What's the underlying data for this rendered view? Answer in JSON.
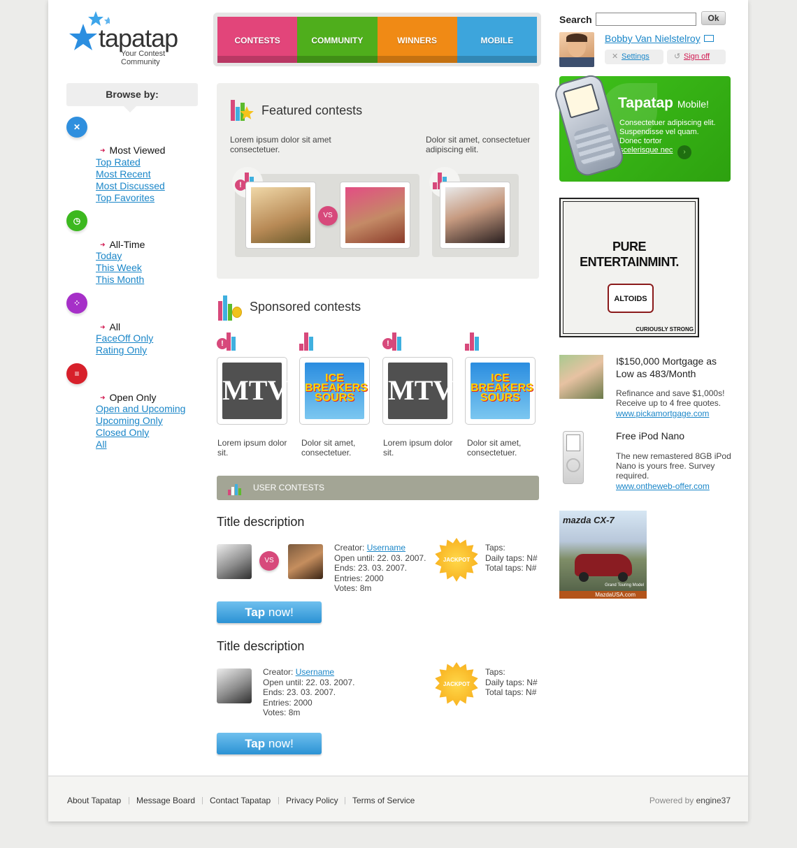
{
  "brand": {
    "name": "tapatap",
    "tagline": "Your Contest Community"
  },
  "nav": [
    {
      "label": "CONTESTS",
      "color": "#e2457a"
    },
    {
      "label": "COMMUNITY",
      "color": "#4fae1c"
    },
    {
      "label": "WINNERS",
      "color": "#f08a15"
    },
    {
      "label": "MOBILE",
      "color": "#3da5dc"
    }
  ],
  "search": {
    "label": "Search",
    "value": "",
    "button": "Ok"
  },
  "user": {
    "name": "Bobby Van Nielstelroy",
    "settings": "Settings",
    "signoff": "Sign off"
  },
  "browse": {
    "title": "Browse by:",
    "groups": [
      {
        "icon": "wrench-icon",
        "color": "#2f8fde",
        "current": "Most Viewed",
        "links": [
          "Top Rated",
          "Most Recent",
          "Most Discussed",
          "Top Favorites"
        ]
      },
      {
        "icon": "clock-icon",
        "color": "#3cb81f",
        "current": "All-Time",
        "links": [
          "Today",
          "This Week",
          "This Month"
        ]
      },
      {
        "icon": "dots-icon",
        "color": "#a630c8",
        "current": "All",
        "links": [
          "FaceOff Only",
          "Rating Only"
        ]
      },
      {
        "icon": "list-icon",
        "color": "#d7202b",
        "current": "Open Only",
        "links": [
          "Open and Upcoming",
          "Upcoming Only",
          "Closed Only",
          "All"
        ]
      }
    ]
  },
  "featured": {
    "title": "Featured contests",
    "desc1": "Lorem ipsum dolor sit amet consectetuer.",
    "desc2": "Dolor sit amet, consectetuer adipiscing elit.",
    "vs": "VS"
  },
  "sponsored": {
    "title": "Sponsored contests",
    "items": [
      {
        "brand": "MTV",
        "caption": "Lorem ipsum dolor sit."
      },
      {
        "brand": "ICE BREAKERS SOURS",
        "caption": "Dolor sit amet, consectetuer."
      },
      {
        "brand": "MTV",
        "caption": "Lorem ipsum dolor sit."
      },
      {
        "brand": "ICE BREAKERS SOURS",
        "caption": "Dolor sit amet, consectetuer."
      }
    ]
  },
  "user_contests": {
    "bar": "USER CONTESTS",
    "items": [
      {
        "title": "Title description",
        "creator_label": "Creator:",
        "creator": "Username",
        "open": "Open until:  22. 03. 2007.",
        "ends": "Ends: 23. 03. 2007.",
        "entries": "Entries: 2000",
        "votes": "Votes: 8m",
        "jackpot": "JACKPOT",
        "taps": "Taps:",
        "daily": "Daily taps: N#",
        "total": "Total taps: N#",
        "button_bold": "Tap",
        "button_rest": " now!"
      },
      {
        "title": "Title description",
        "creator_label": "Creator:",
        "creator": "Username",
        "open": "Open until:  22. 03. 2007.",
        "ends": "Ends: 23. 03. 2007.",
        "entries": "Entries: 2000",
        "votes": "Votes: 8m",
        "jackpot": "JACKPOT",
        "taps": "Taps:",
        "daily": "Daily taps: N#",
        "total": "Total taps: N#",
        "button_bold": "Tap",
        "button_rest": " now!"
      }
    ]
  },
  "mobile": {
    "title": "Tapatap",
    "title2": "Mobile!",
    "text1": "Consectetuer adipiscing elit.",
    "text2": "Suspendisse vel quam.",
    "text3": "Donec tortor",
    "link": "scelerisque nec"
  },
  "ad_altoids": {
    "line1": "PURE",
    "line2": "ENTERTAINMINT.",
    "brand": "ALTOIDS",
    "foot": "CURIOUSLY STRONG"
  },
  "ads": [
    {
      "title": "I$150,000 Mortgage as Low as 483/Month",
      "text": "Refinance and save $1,000s! Receive up to 4 free quotes.",
      "url": "www.pickamortgage.com"
    },
    {
      "title": "Free iPod Nano",
      "text": "The new remastered 8GB iPod Nano is yours free. Survey required.",
      "url": "www.ontheweb-offer.com"
    }
  ],
  "mazda": {
    "brand": "mazda CX-7",
    "sub": "Grand Touring Model",
    "url": "MazdaUSA.com"
  },
  "footer": {
    "links": [
      "About Tapatap",
      "Message Board",
      "Contact Tapatap",
      "Privacy Policy",
      "Terms of Service"
    ],
    "powered_label": "Powered by",
    "powered_by": "engine37"
  }
}
